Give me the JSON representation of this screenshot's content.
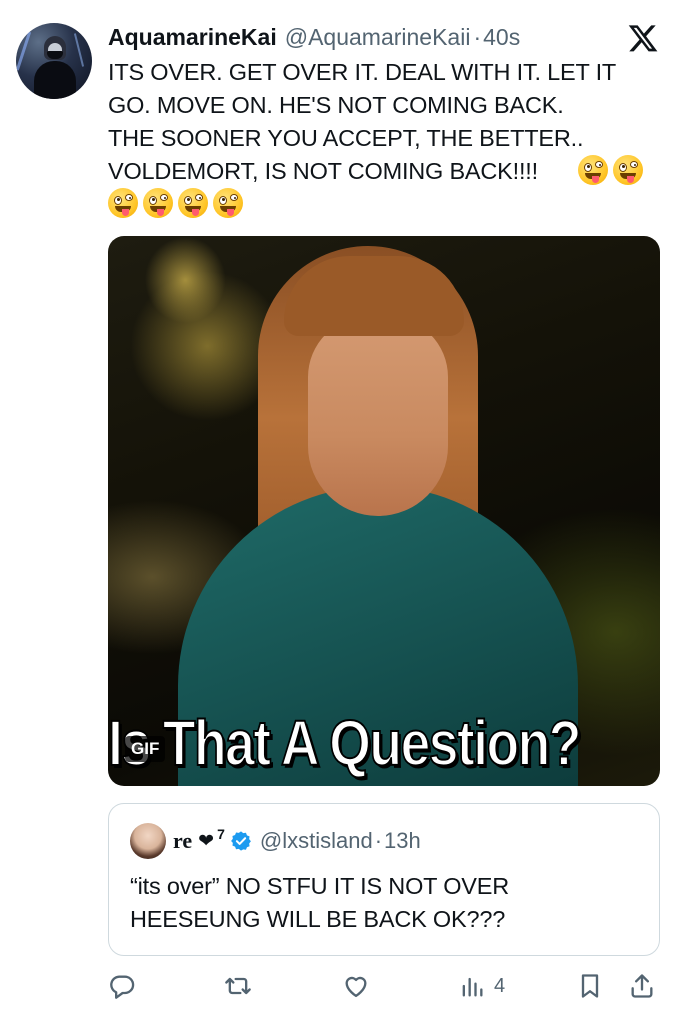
{
  "tweet": {
    "display_name": "AquamarineKai",
    "handle": "@AquamarineKaii",
    "separator": "·",
    "time": "40s",
    "text_lines": [
      "ITS OVER. GET OVER IT. DEAL WITH  IT. LET IT",
      "GO. MOVE ON. HE'S NOT COMING BACK.",
      "THE SOONER YOU ACCEPT, THE BETTER..",
      "VOLDEMORT, IS NOT COMING BACK!!!!"
    ],
    "emoji_name": "zany-face-emoji",
    "media": {
      "caption": "Is That A Question?",
      "badge": "GIF"
    }
  },
  "quote": {
    "name": "re",
    "name_decoration": "❤",
    "name_superscript": "7",
    "handle": "@lxstisland",
    "separator": "·",
    "time": "13h",
    "text_lines": [
      "“its over” NO STFU IT IS NOT OVER",
      "HEESEUNG WILL BE BACK OK???"
    ],
    "verified_color": "#1d9bf0"
  },
  "actions": {
    "reply_icon": "reply-icon",
    "retweet_icon": "retweet-icon",
    "like_icon": "heart-icon",
    "views_icon": "views-icon",
    "views_count": "4",
    "bookmark_icon": "bookmark-icon",
    "share_icon": "share-icon"
  },
  "colors": {
    "text": "#0f1419",
    "secondary": "#536471",
    "border": "#cfd9de"
  }
}
